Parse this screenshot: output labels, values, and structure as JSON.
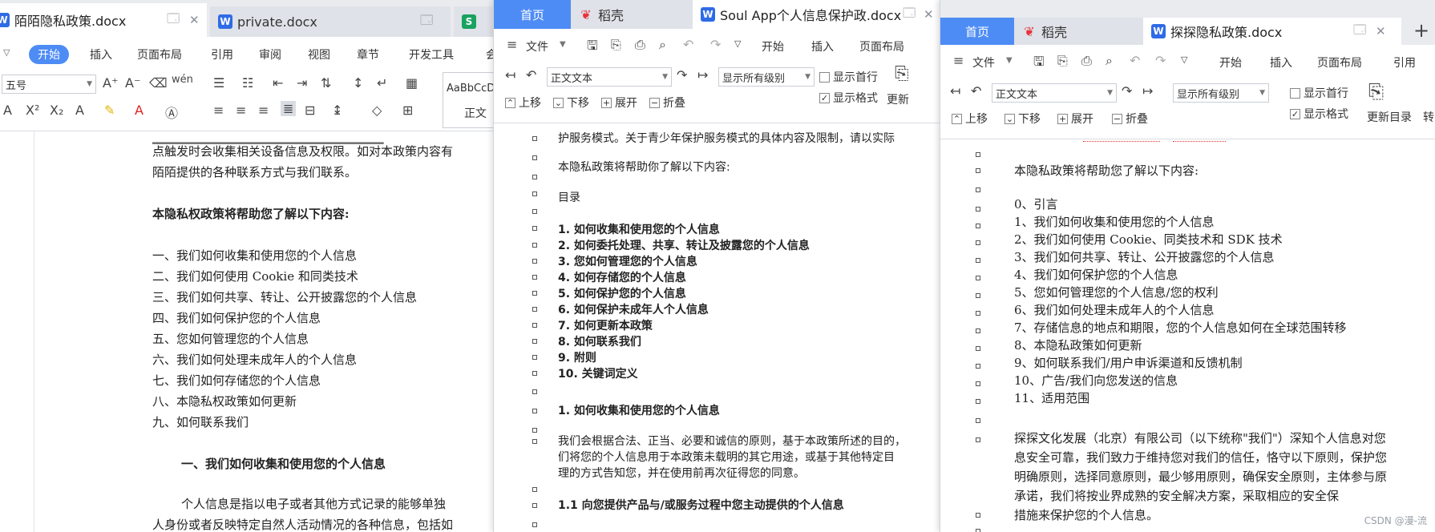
{
  "colors": {
    "accent": "#4e8cf5",
    "word_icon": "#2f6be6",
    "daoke_red": "#e8323c"
  },
  "win1": {
    "tabs": [
      {
        "label": "陌陌隐私政策.docx",
        "icon": "word-icon"
      },
      {
        "label": "private.docx",
        "icon": "word-icon"
      },
      {
        "label": "S",
        "icon": "sheet-icon"
      }
    ],
    "ribbon_tabs": [
      "开始",
      "插入",
      "页面布局",
      "引用",
      "审阅",
      "视图",
      "章节",
      "开发工具",
      "会"
    ],
    "font_size": "五号",
    "style_preview": "AaBbCcD",
    "style_name": "正文",
    "lines": [
      "点触发时会收集相关设备信息及权限。如对本政策内容有",
      "陌陌提供的各种联系方式与我们联系。",
      "本隐私权政策将帮助您了解以下内容:",
      "一、我们如何收集和使用您的个人信息",
      "二、我们如何使用 Cookie 和同类技术",
      "三、我们如何共享、转让、公开披露您的个人信息",
      "四、我们如何保护您的个人信息",
      "五、您如何管理您的个人信息",
      "六、我们如何处理未成年人的个人信息",
      "七、我们如何存储您的个人信息",
      "八、本隐私权政策如何更新",
      "九、如何联系我们",
      "一、我们如何收集和使用您的个人信息",
      "个人信息是指以电子或者其他方式记录的能够单独",
      "人身份或者反映特定自然人活动情况的各种信息，包括如"
    ]
  },
  "win2": {
    "tabs": [
      {
        "label": "首页"
      },
      {
        "label": "稻壳",
        "icon": "daoke-icon"
      },
      {
        "label": "Soul App个人信息保护政.docx",
        "icon": "word-icon"
      }
    ],
    "file_menu": "文件",
    "ribbon_tabs": [
      "开始",
      "插入",
      "页面布局"
    ],
    "style_select": "正文文本",
    "level_select": "显示所有级别",
    "show_first_line": "显示首行",
    "show_format": "显示格式",
    "update": "更新",
    "move_up": "上移",
    "move_down": "下移",
    "expand": "展开",
    "collapse": "折叠",
    "lines": [
      "护服务模式。关于青少年保护服务模式的具体内容及限制，请以实际",
      "本隐私政策将帮助你了解以下内容:",
      "目录",
      "1.  如何收集和使用您的个人信息",
      "2.  如何委托处理、共享、转让及披露您的个人信息",
      "3.  您如何管理您的个人信息",
      "4.  如何存储您的个人信息",
      "5.  如何保护您的个人信息",
      "6.  如何保护未成年人个人信息",
      "7.  如何更新本政策",
      "8.  如何联系我们",
      "9.  附则",
      "10.  关键词定义",
      "1.  如何收集和使用您的个人信息",
      "我们会根据合法、正当、必要和诚信的原则，基于本政策所述的目的，",
      "们将您的个人信息用于本政策未载明的其它用途，或基于其他特定目",
      "理的方式告知您，并在使用前再次征得您的同意。",
      "1.1  向您提供产品与/或服务过程中您主动提供的个人信息"
    ]
  },
  "win3": {
    "tabs": [
      {
        "label": "首页"
      },
      {
        "label": "稻壳",
        "icon": "daoke-icon"
      },
      {
        "label": "探探隐私政策.docx",
        "icon": "word-icon"
      }
    ],
    "file_menu": "文件",
    "ribbon_tabs": [
      "开始",
      "插入",
      "页面布局",
      "引用"
    ],
    "style_select": "正文文本",
    "level_select": "显示所有级别",
    "show_first_line": "显示首行",
    "show_format": "显示格式",
    "update_toc": "更新目录",
    "convert": "转",
    "move_up": "上移",
    "move_down": "下移",
    "expand": "展开",
    "collapse": "折叠",
    "lines": [
      "本隐私政策将帮助您了解以下内容:",
      "0、引言",
      "1、我们如何收集和使用您的个人信息",
      "2、我们如何使用 Cookie、同类技术和 SDK 技术",
      "3、我们如何共享、转让、公开披露您的个人信息",
      "4、我们如何保护您的个人信息",
      "5、您如何管理您的个人信息/您的权利",
      "6、我们如何处理未成年人的个人信息",
      "7、存储信息的地点和期限，您的个人信息如何在全球范围转移",
      "8、本隐私政策如何更新",
      "9、如何联系我们/用户申诉渠道和反馈机制",
      "10、广告/我们向您发送的信息",
      "11、适用范围",
      "探探文化发展（北京）有限公司（以下统称\"我们\"）深知个人信息对您",
      "息安全可靠，我们致力于维持您对我们的信任，恪守以下原则，保护您",
      "明确原则，选择同意原则，最少够用原则，确保安全原则，主体参与原",
      "承诺，我们将按业界成熟的安全解决方案，采取相应的安全保",
      "措施来保护您的个人信息。"
    ]
  },
  "watermark": "CSDN @漫-流"
}
